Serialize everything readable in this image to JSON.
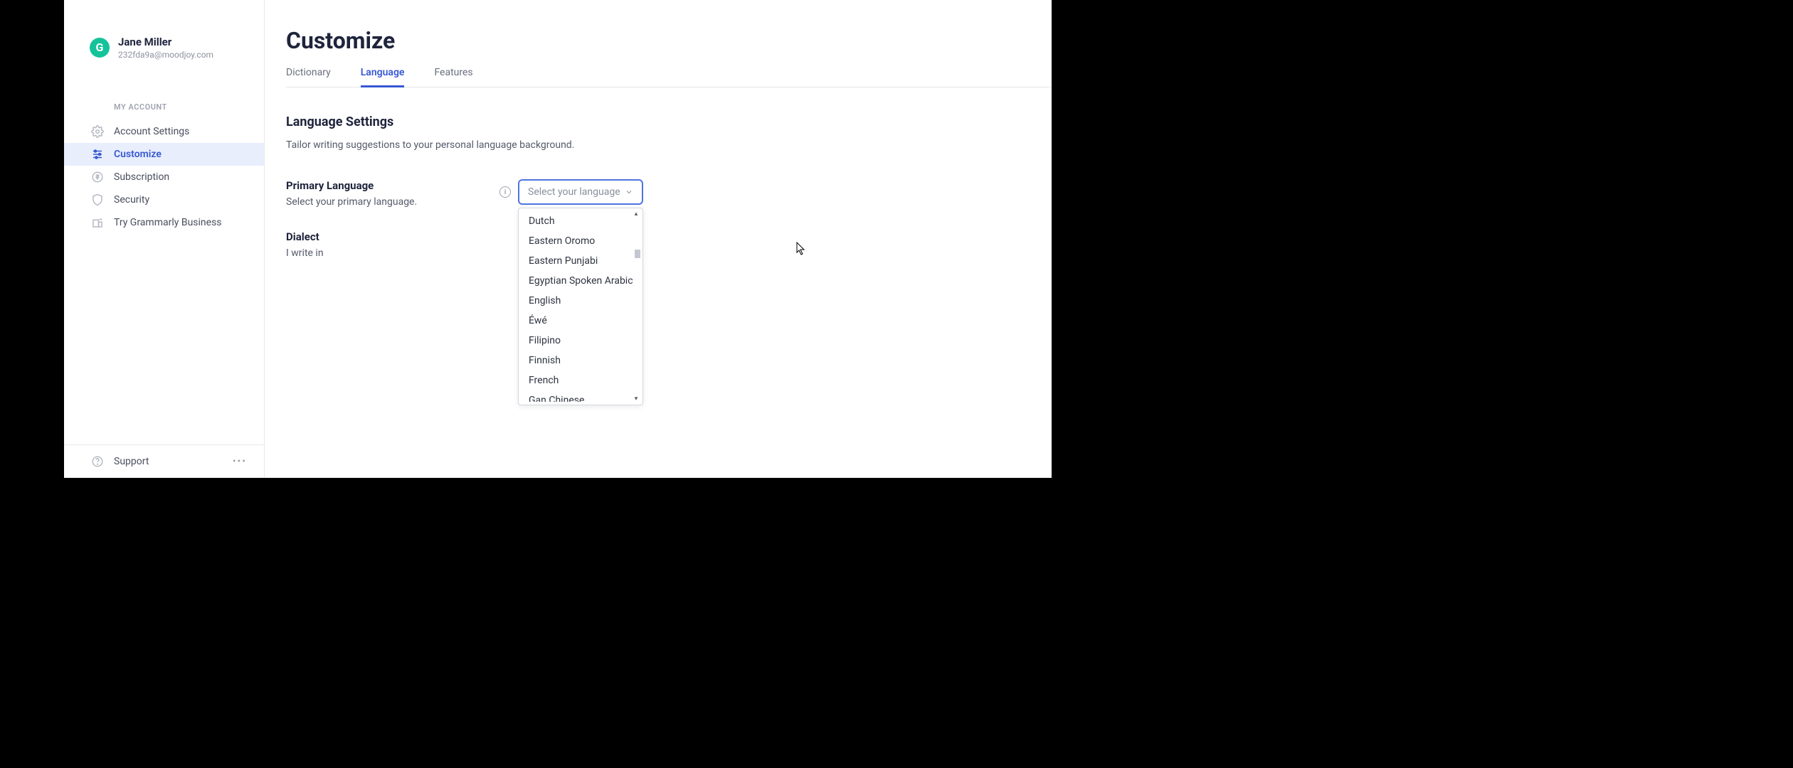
{
  "user": {
    "avatar_initial": "G",
    "name": "Jane Miller",
    "email": "232fda9a@moodjoy.com"
  },
  "sidebar": {
    "section_label": "MY ACCOUNT",
    "items": [
      {
        "label": "Account Settings"
      },
      {
        "label": "Customize"
      },
      {
        "label": "Subscription"
      },
      {
        "label": "Security"
      },
      {
        "label": "Try Grammarly Business"
      }
    ],
    "support_label": "Support"
  },
  "page": {
    "title": "Customize",
    "tabs": [
      {
        "label": "Dictionary"
      },
      {
        "label": "Language"
      },
      {
        "label": "Features"
      }
    ],
    "section_heading": "Language Settings",
    "section_desc": "Tailor writing suggestions to your personal language background.",
    "primary_language": {
      "label": "Primary Language",
      "help": "Select your primary language.",
      "placeholder": "Select your language"
    },
    "dialect": {
      "label": "Dialect",
      "help": "I write in"
    },
    "dropdown_options": [
      "Dutch",
      "Eastern Oromo",
      "Eastern Punjabi",
      "Egyptian Spoken Arabic",
      "English",
      "Éwé",
      "Filipino",
      "Finnish",
      "French",
      "Gan Chinese"
    ]
  }
}
